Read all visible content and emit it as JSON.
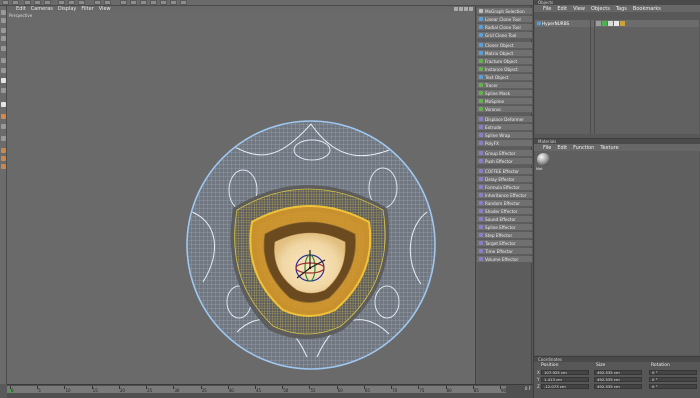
{
  "viewport": {
    "menu": [
      "Edit",
      "Cameras",
      "Display",
      "Filter",
      "View"
    ],
    "label": "Perspective"
  },
  "palette": {
    "items": [
      {
        "label": "MoGraph Selection",
        "color": "#bfbfbf"
      },
      {
        "label": "Linear Clone Tool",
        "color": "#57a0d8"
      },
      {
        "label": "Radial Clone Tool",
        "color": "#57a0d8"
      },
      {
        "label": "Grid Clone Tool",
        "color": "#57a0d8"
      },
      {
        "label": "Cloner Object",
        "color": "#57a0d8"
      },
      {
        "label": "Matrix Object",
        "color": "#57a0d8"
      },
      {
        "label": "Fracture Object",
        "color": "#67b04c"
      },
      {
        "label": "Instance Object",
        "color": "#67b04c"
      },
      {
        "label": "Text Object",
        "color": "#57a0d8"
      },
      {
        "label": "Tracer",
        "color": "#67b04c"
      },
      {
        "label": "Spline Mask",
        "color": "#67b04c"
      },
      {
        "label": "MoSpline",
        "color": "#67b04c"
      },
      {
        "label": "Voronoi",
        "color": "#67b04c"
      },
      {
        "label": "Displace Deformer",
        "color": "#8f7cc8"
      },
      {
        "label": "Extrude",
        "color": "#8f7cc8"
      },
      {
        "label": "Spline Wrap",
        "color": "#8f7cc8"
      },
      {
        "label": "PolyFX",
        "color": "#8f7cc8"
      },
      {
        "label": "Group Effector",
        "color": "#8f7cc8"
      },
      {
        "label": "Push Effector",
        "color": "#8f7cc8"
      },
      {
        "label": "COFFEE Effector",
        "color": "#8f7cc8"
      },
      {
        "label": "Delay Effector",
        "color": "#8f7cc8"
      },
      {
        "label": "Formula Effector",
        "color": "#8f7cc8"
      },
      {
        "label": "Inheritance Effector",
        "color": "#8f7cc8"
      },
      {
        "label": "Random Effector",
        "color": "#8f7cc8"
      },
      {
        "label": "Shader Effector",
        "color": "#8f7cc8"
      },
      {
        "label": "Sound Effector",
        "color": "#8f7cc8"
      },
      {
        "label": "Spline Effector",
        "color": "#8f7cc8"
      },
      {
        "label": "Step Effector",
        "color": "#8f7cc8"
      },
      {
        "label": "Target Effector",
        "color": "#8f7cc8"
      },
      {
        "label": "Time Effector",
        "color": "#8f7cc8"
      },
      {
        "label": "Volume Effector",
        "color": "#8f7cc8"
      }
    ]
  },
  "objects": {
    "title": "Objects",
    "menu": [
      "File",
      "Edit",
      "View",
      "Objects",
      "Tags",
      "Bookmarks"
    ],
    "row_name": "HyperNURBS"
  },
  "materials": {
    "title": "Materials",
    "menu": [
      "File",
      "Edit",
      "Function",
      "Texture"
    ],
    "mat_name": "Mat"
  },
  "coordinates": {
    "title": "Coordinates",
    "headers": [
      "Position",
      "Size",
      "Rotation"
    ],
    "rows": [
      {
        "axis": "X",
        "pos": "107.925 cm",
        "size": "492.535 cm",
        "rot": "0 °"
      },
      {
        "axis": "Y",
        "pos": "1.413 cm",
        "size": "492.535 cm",
        "rot": "0 °"
      },
      {
        "axis": "Z",
        "pos": "-12.073 cm",
        "size": "492.535 cm",
        "rot": "0 °"
      }
    ]
  },
  "timeline": {
    "ticks": [
      "0",
      "5",
      "10",
      "15",
      "20",
      "25",
      "30",
      "35",
      "40",
      "45",
      "50",
      "55",
      "60",
      "65",
      "70",
      "75",
      "80",
      "85",
      "90"
    ],
    "end": "0 F"
  }
}
